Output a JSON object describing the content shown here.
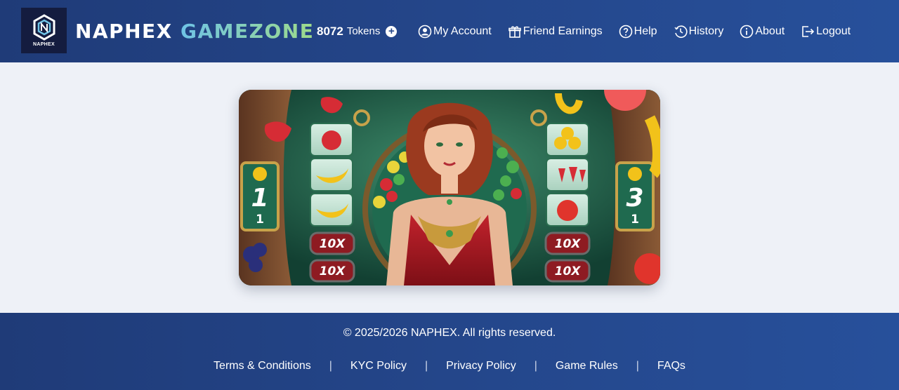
{
  "header": {
    "logo_text": "NAPHEX",
    "brand_word1": "NAPHEX",
    "brand_word2": "GAMEZONE",
    "tokens_count": "8072",
    "tokens_label": "Tokens",
    "menu": [
      {
        "label": "My Account",
        "icon": "user-circle-icon"
      },
      {
        "label": "Friend Earnings",
        "icon": "gift-icon"
      },
      {
        "label": "Help",
        "icon": "question-circle-icon"
      },
      {
        "label": "History",
        "icon": "history-icon"
      },
      {
        "label": "About",
        "icon": "info-circle-icon"
      },
      {
        "label": "Logout",
        "icon": "logout-icon"
      }
    ]
  },
  "banner": {
    "left_counter": {
      "big": "1",
      "small": "1"
    },
    "right_counter": {
      "big": "3",
      "small": "1"
    },
    "multiplier_label": "10X"
  },
  "footer": {
    "copyright": "© 2025/2026 NAPHEX. All rights reserved.",
    "links": [
      "Terms & Conditions",
      "KYC Policy",
      "Privacy Policy",
      "Game Rules",
      "FAQs"
    ]
  },
  "colors": {
    "header_bg": "#24468a",
    "brand_accent_start": "#6fc3e6",
    "brand_accent_end": "#9edb8a",
    "multiplier_red": "#8e1b22"
  }
}
